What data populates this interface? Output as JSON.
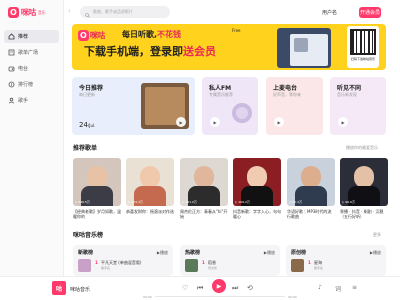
{
  "app": {
    "logo_text": "咪咕",
    "logo_badge": "O",
    "logo_sub": "音乐"
  },
  "sidebar": {
    "items": [
      {
        "label": "推荐",
        "icon": "home-icon",
        "active": true
      },
      {
        "label": "歌单广场",
        "icon": "playlist-icon",
        "active": false
      },
      {
        "label": "电台",
        "icon": "radio-icon",
        "active": false
      },
      {
        "label": "排行榜",
        "icon": "chart-icon",
        "active": false
      },
      {
        "label": "歌手",
        "icon": "singer-icon",
        "active": false
      }
    ]
  },
  "topbar": {
    "search_placeholder": "歌曲、歌手或品质影片",
    "user_label": "用户名",
    "vip_label": "开通会员"
  },
  "banner": {
    "line1_a": "每日听歌,",
    "line1_b": "不花钱",
    "tag": "Free",
    "line2_a": "下载手机端，登录即",
    "line2_b": "送会员",
    "qr_caption": "扫码下载咪咕音乐"
  },
  "cards": {
    "daily": {
      "title": "今日推荐",
      "sub": "每日更新",
      "day": "24",
      "month": "/Jul."
    },
    "fm": {
      "title": "私人FM",
      "sub": "专属音乐推荐"
    },
    "radio": {
      "title": "上麦电台",
      "sub": "好声音，等你来"
    },
    "listen": {
      "title": "听见不同",
      "sub": "音乐新发现"
    }
  },
  "sections": {
    "playlists": {
      "title": "推荐歌单",
      "more": "播放你的最爱音乐"
    },
    "charts": {
      "title": "咪咕音乐榜",
      "more": "更多"
    }
  },
  "playlists": [
    {
      "caption": "【经典老歌】岁月如歌，温暖你的",
      "count": "▷ 346.5万",
      "bg": "#d4c6bd",
      "face": "#e8c2a5",
      "body": "#3c3c46"
    },
    {
      "caption": "恭喜发财你：摇滚派对作选",
      "count": "▷ 123.3万",
      "bg": "#e9e2d4",
      "face": "#f0c9ad",
      "body": "#c66a4f"
    },
    {
      "caption": "周杰伦正方：青春从\"hi\"开始",
      "count": "▷ 281.0万",
      "bg": "#ddd8d2",
      "face": "#e0b79d",
      "body": "#2c2c2c"
    },
    {
      "caption": "抖音新歌：字字入心，句句暖心",
      "count": "▷ 169.2万",
      "bg": "#8b1e22",
      "face": "#f1cbb1",
      "body": "#111111"
    },
    {
      "caption": "华语好歌｜MP3时代的流行歌曲",
      "count": "▷ 52.4万",
      "bg": "#c9d2dc",
      "face": "#dcae8e",
      "body": "#2f3b4e"
    },
    {
      "caption": "季播 · 抖音 · 刷剧 · 沉稳（五行好听）",
      "count": "▷ 96.6万",
      "bg": "#2b2e38",
      "face": "#e4c0a6",
      "body": "#0f0f14"
    }
  ],
  "charts": [
    {
      "title": "新歌榜",
      "play": "▶播放",
      "num": "1",
      "song": "平凡天堂 (单曲混音版)",
      "artist": "歌手名",
      "cover": "#c8a0c8"
    },
    {
      "title": "热歌榜",
      "play": "▶播放",
      "num": "1",
      "song": "稻香",
      "artist": "周杰伦",
      "cover": "#5a7a5a"
    },
    {
      "title": "原创榜",
      "play": "▶播放",
      "num": "1",
      "song": "星海",
      "artist": "歌手名",
      "cover": "#8a6a4a"
    }
  ],
  "player": {
    "title": "咪咕音乐",
    "cover_text": "咕",
    "time_current": "00:00",
    "time_total": "00:00",
    "progress": 0
  }
}
